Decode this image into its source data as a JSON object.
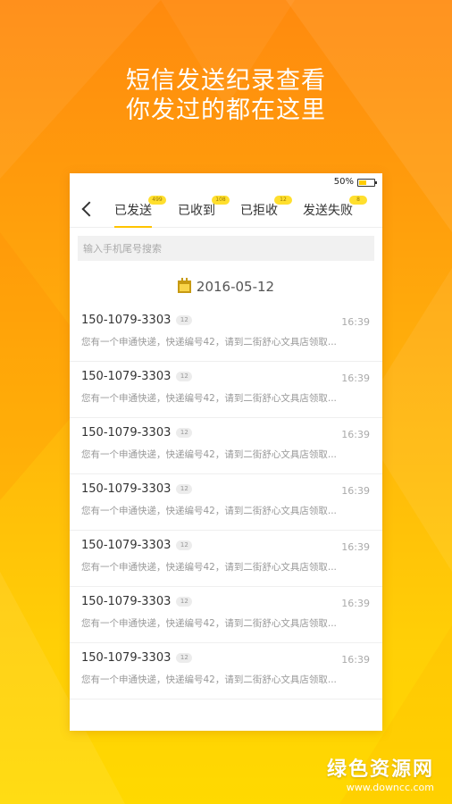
{
  "headline": {
    "line1": "短信发送纪录查看",
    "line2": "你发过的都在这里"
  },
  "status": {
    "battery_text": "50%",
    "battery_level": 0.5
  },
  "tabs": [
    {
      "label": "已发送",
      "badge": "499",
      "active": true
    },
    {
      "label": "已收到",
      "badge": "108",
      "active": false
    },
    {
      "label": "已拒收",
      "badge": "12",
      "active": false
    },
    {
      "label": "发送失败",
      "badge": "8",
      "active": false
    }
  ],
  "search": {
    "placeholder": "输入手机尾号搜索",
    "value": ""
  },
  "date_header": "2016-05-12",
  "messages": [
    {
      "phone": "150-1079-3303",
      "count": "12",
      "time": "16:39",
      "body": "您有一个申通快递，快递编号42，请到二街舒心文具店领取..."
    },
    {
      "phone": "150-1079-3303",
      "count": "12",
      "time": "16:39",
      "body": "您有一个申通快递，快递编号42，请到二街舒心文具店领取..."
    },
    {
      "phone": "150-1079-3303",
      "count": "12",
      "time": "16:39",
      "body": "您有一个申通快递，快递编号42，请到二街舒心文具店领取..."
    },
    {
      "phone": "150-1079-3303",
      "count": "12",
      "time": "16:39",
      "body": "您有一个申通快递，快递编号42，请到二街舒心文具店领取..."
    },
    {
      "phone": "150-1079-3303",
      "count": "12",
      "time": "16:39",
      "body": "您有一个申通快递，快递编号42，请到二街舒心文具店领取..."
    },
    {
      "phone": "150-1079-3303",
      "count": "12",
      "time": "16:39",
      "body": "您有一个申通快递，快递编号42，请到二街舒心文具店领取..."
    },
    {
      "phone": "150-1079-3303",
      "count": "12",
      "time": "16:39",
      "body": "您有一个申通快递，快递编号42，请到二街舒心文具店领取..."
    }
  ],
  "watermark": {
    "title": "绿色资源网",
    "url": "www.downcc.com"
  },
  "colors": {
    "accent": "#ffc400",
    "badge": "#ffdf2e",
    "background_top": "#ff8a0e",
    "background_bottom": "#ffd900"
  }
}
